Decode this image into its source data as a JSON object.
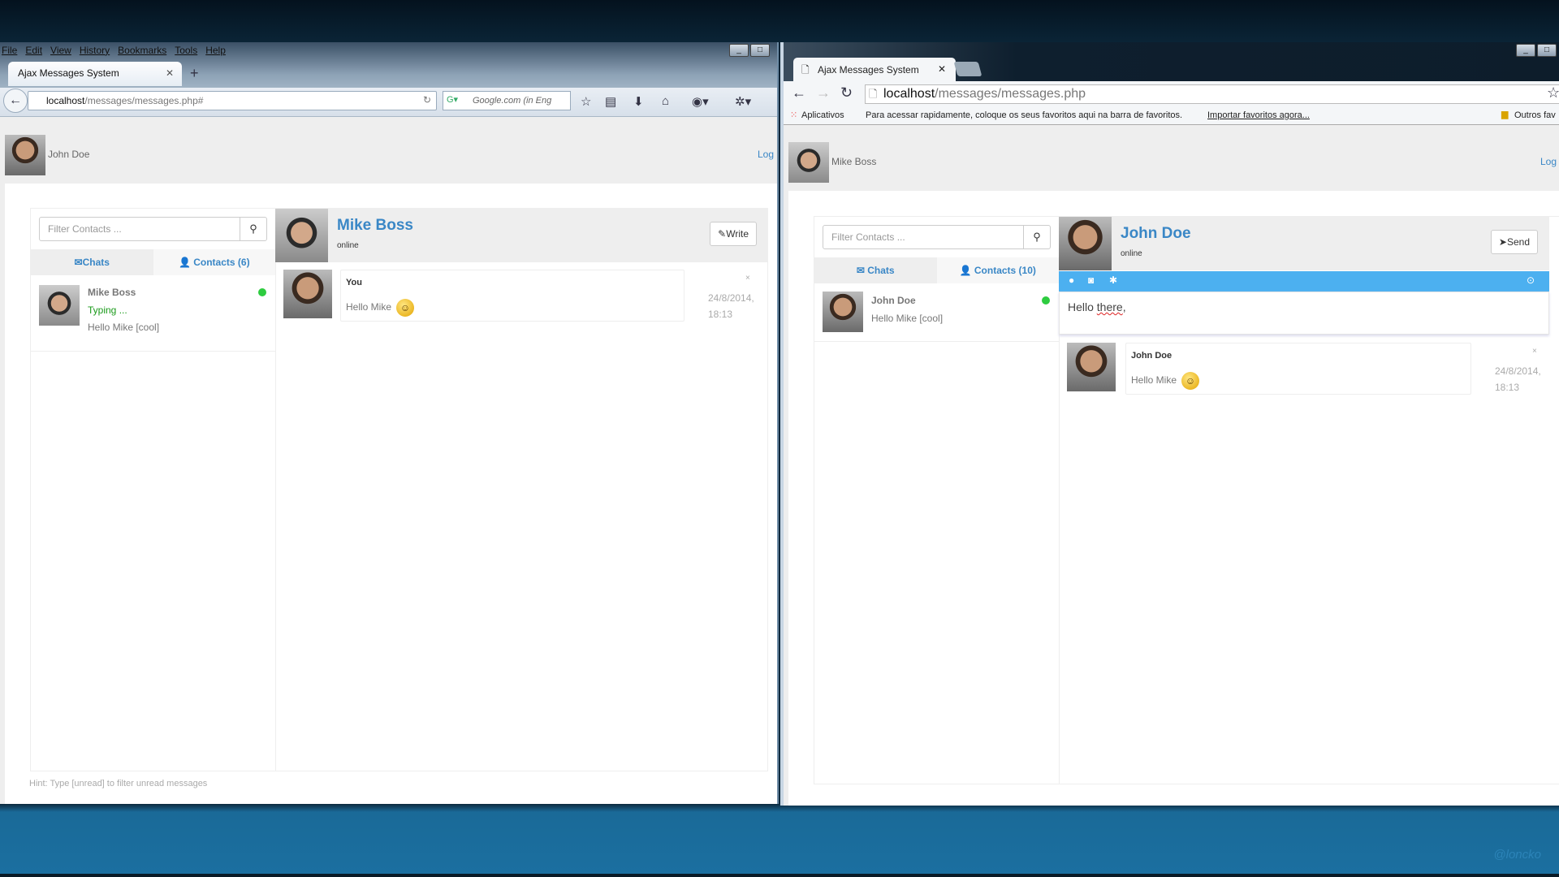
{
  "firefox": {
    "menu": [
      "File",
      "Edit",
      "View",
      "History",
      "Bookmarks",
      "Tools",
      "Help"
    ],
    "tab_title": "Ajax Messages System",
    "new_tab": "+",
    "url_host": "localhost",
    "url_path": "/messages/messages.php#",
    "search_placeholder": "Google.com (in Eng",
    "page": {
      "user_name": "John Doe",
      "logout": "Log",
      "filter_placeholder": "Filter Contacts ...",
      "tab_chats": "Chats",
      "tab_contacts": "Contacts (6)",
      "contact": {
        "name": "Mike Boss",
        "typing": "Typing ...",
        "last": "Hello Mike [cool]",
        "status_color": "#2ecc40"
      },
      "chat": {
        "name": "Mike Boss",
        "status": "online",
        "button": "Write"
      },
      "message": {
        "sender": "You",
        "text": "Hello Mike",
        "date": "24/8/2014,",
        "time": "18:13",
        "close": "×"
      },
      "hint": "Hint: Type [unread] to filter unread messages"
    }
  },
  "chrome": {
    "tab_title": "Ajax Messages System",
    "url_host": "localhost",
    "url_path": "/messages/messages.php",
    "bookmarks": {
      "apps": "Aplicativos",
      "text": "Para acessar rapidamente, coloque os seus favoritos aqui na barra de favoritos.",
      "import": "Importar favoritos agora...",
      "other": "Outros fav"
    },
    "page": {
      "user_name": "Mike Boss",
      "logout": "Log",
      "filter_placeholder": "Filter Contacts ...",
      "tab_chats": "Chats",
      "tab_contacts": "Contacts (10)",
      "contact": {
        "name": "John Doe",
        "last": "Hello Mike [cool]",
        "status_color": "#2ecc40"
      },
      "chat": {
        "name": "John Doe",
        "status": "online",
        "button": "Send"
      },
      "compose_text": "Hello ",
      "compose_misspelled": "there",
      "compose_tail": ",",
      "message": {
        "sender": "John Doe",
        "text": "Hello Mike",
        "date": "24/8/2014,",
        "time": "18:13",
        "close": "×"
      }
    }
  },
  "watermark": "@loncko",
  "colors": {
    "accent": "#3a87c6",
    "toolbar": "#4cb0f0",
    "online": "#2ecc40"
  }
}
